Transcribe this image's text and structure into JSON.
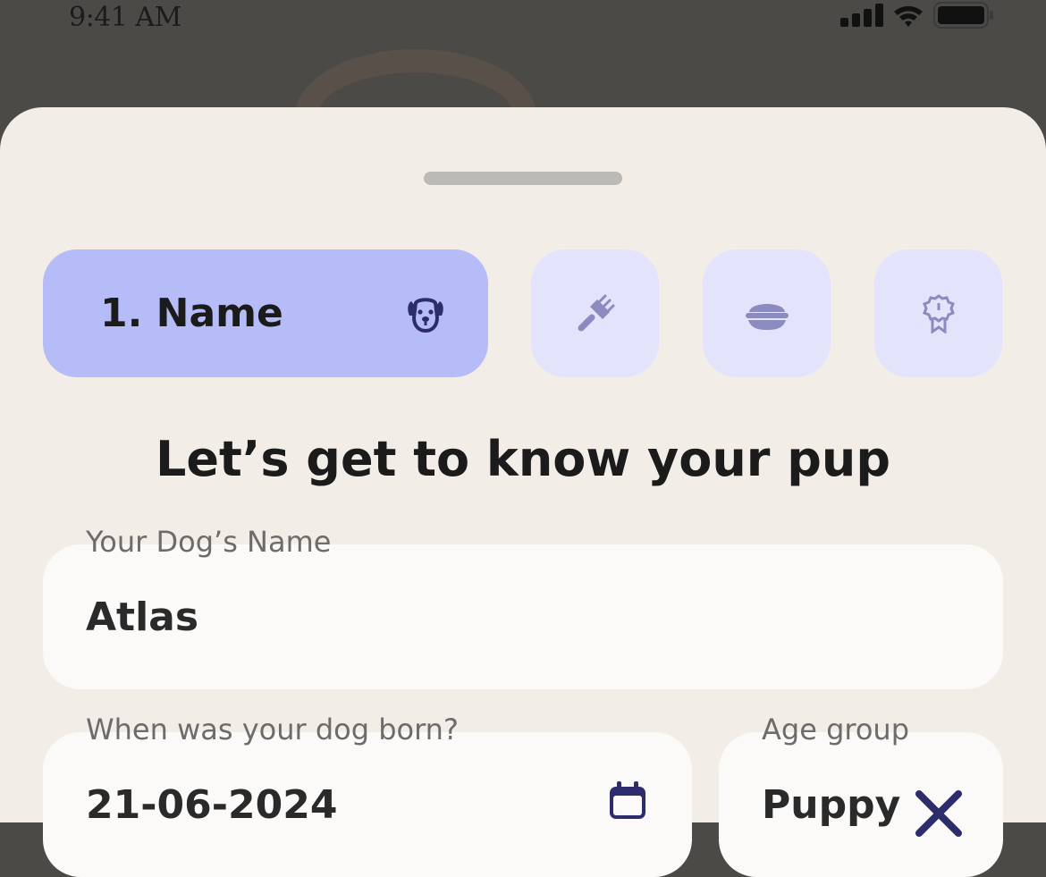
{
  "status_bar": {
    "time": "9:41 AM"
  },
  "colors": {
    "overlay": "#4b4a47",
    "sheet": "#f2eee7",
    "active_step": "#b6bcf8",
    "inactive_step": "#e3e3fb",
    "icon_dark": "#2d2d6e",
    "icon_muted": "#8b8bc0",
    "field_bg": "#fbfaf8"
  },
  "steps": [
    {
      "label": "1. Name",
      "icon": "dog-face-icon",
      "active": true
    },
    {
      "label": "",
      "icon": "brush-icon",
      "active": false
    },
    {
      "label": "",
      "icon": "food-bowl-icon",
      "active": false
    },
    {
      "label": "",
      "icon": "award-badge-icon",
      "active": false
    }
  ],
  "heading": "Let’s get to know your pup",
  "form": {
    "dog_name": {
      "label": "Your Dog’s Name",
      "value": "Atlas"
    },
    "birth_date": {
      "label": "When was your dog born?",
      "value": "21-06-2024",
      "icon": "calendar-icon"
    },
    "age_group": {
      "label": "Age group",
      "value": "Puppy",
      "icon": "close-icon"
    }
  }
}
